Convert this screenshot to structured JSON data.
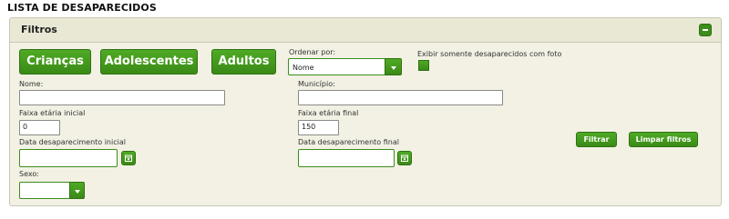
{
  "page_title": "LISTA DE DESAPARECIDOS",
  "filters": {
    "header": "Filtros",
    "buttons": {
      "criancas": "Crianças",
      "adolescentes": "Adolescentes",
      "adultos": "Adultos"
    },
    "ordenar": {
      "label": "Ordenar por:",
      "value": "Nome"
    },
    "exibir_foto": {
      "label": "Exibir somente desaparecidos com foto"
    },
    "nome": {
      "label": "Nome:",
      "value": ""
    },
    "municipio": {
      "label": "Município:",
      "value": ""
    },
    "faixa_inicial": {
      "label": "Faixa etária inicial",
      "value": "0"
    },
    "faixa_final": {
      "label": "Faixa etária final",
      "value": "150"
    },
    "data_inicial": {
      "label": "Data desaparecimento inicial",
      "value": ""
    },
    "data_final": {
      "label": "Data desaparecimento final",
      "value": ""
    },
    "sexo": {
      "label": "Sexo:",
      "value": ""
    },
    "filtrar": "Filtrar",
    "limpar": "Limpar filtros"
  },
  "colors": {
    "accent": "#3c8d1c",
    "panel_bg": "#f2f1e3",
    "panel_header": "#e9e8d5"
  },
  "icons": {
    "collapse": "minus-icon",
    "calendar": "calendar-icon",
    "dropdown": "chevron-down-icon"
  }
}
